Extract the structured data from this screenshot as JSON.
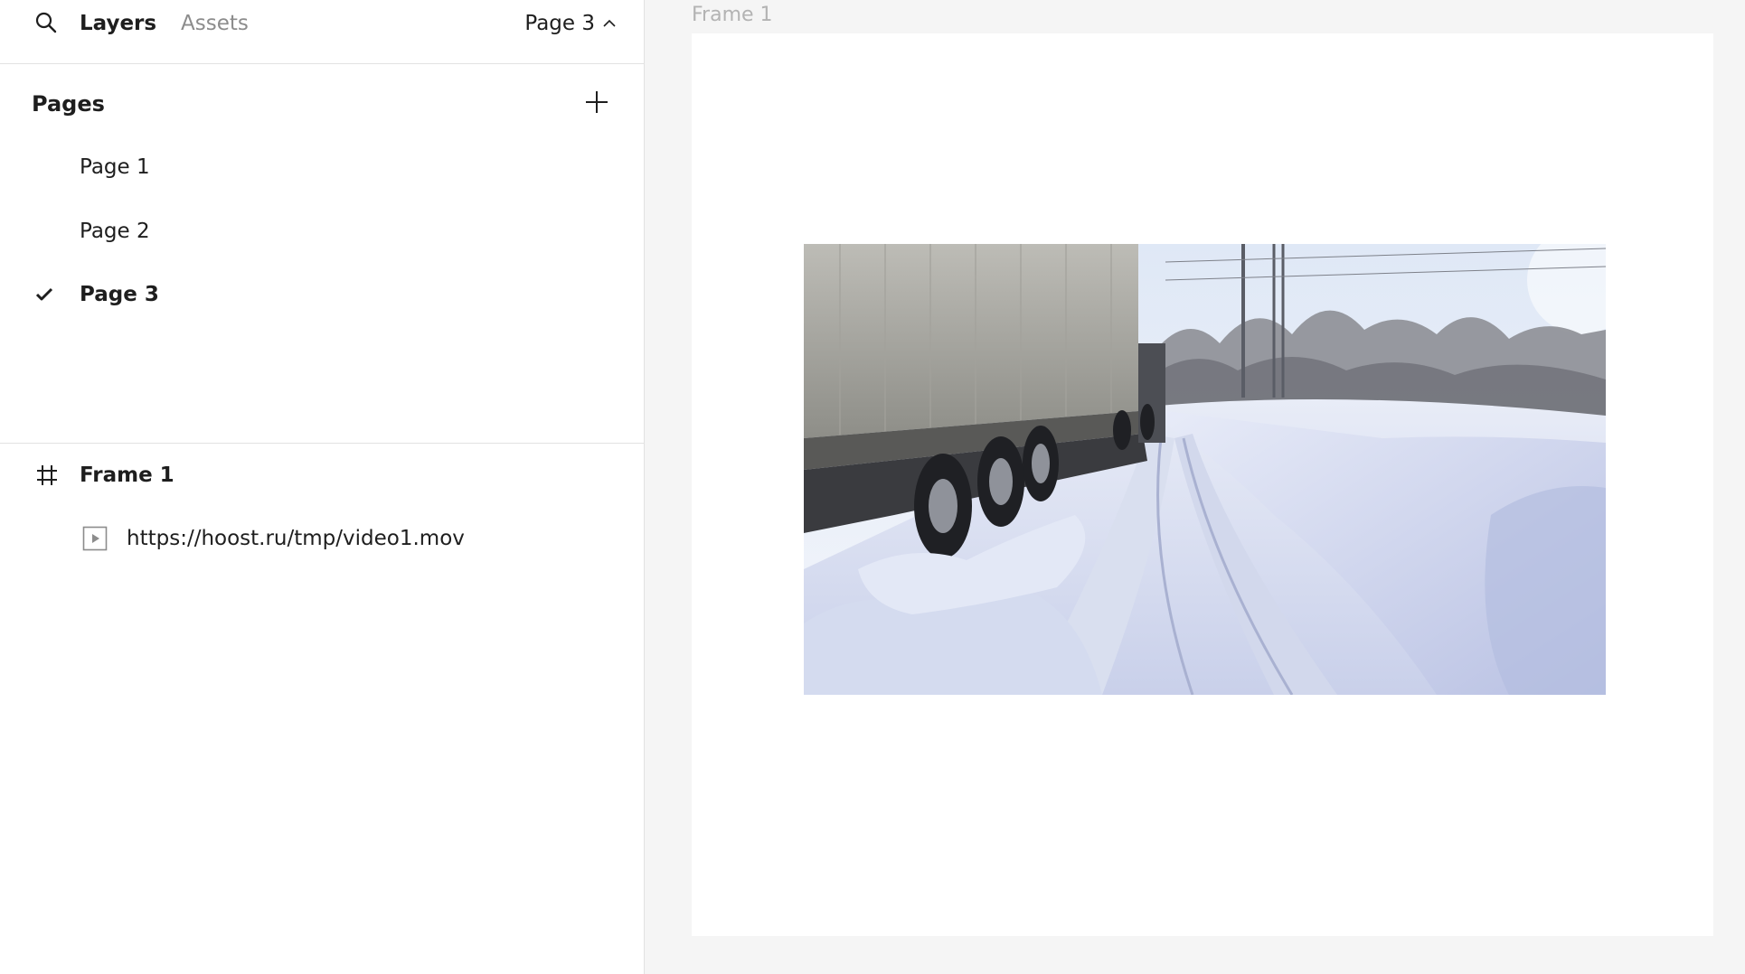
{
  "header": {
    "tabs": [
      {
        "label": "Layers",
        "active": true
      },
      {
        "label": "Assets",
        "active": false
      }
    ],
    "current_page": "Page 3",
    "search_icon": "search-icon",
    "chevron_icon": "chevron-up-icon"
  },
  "pages": {
    "title": "Pages",
    "add_icon": "plus-icon",
    "items": [
      {
        "label": "Page 1",
        "selected": false
      },
      {
        "label": "Page 2",
        "selected": false
      },
      {
        "label": "Page 3",
        "selected": true
      }
    ]
  },
  "layers": {
    "frame": {
      "label": "Frame 1",
      "icon": "frame-hash-icon"
    },
    "children": [
      {
        "label": "https://hoost.ru/tmp/video1.mov",
        "icon": "video-play-icon"
      }
    ]
  },
  "canvas": {
    "frame_label": "Frame 1",
    "video": {
      "content": "snowy road with truck trailer"
    }
  },
  "colors": {
    "panel_bg": "#ffffff",
    "canvas_bg": "#f5f5f5",
    "divider": "#e2e2e2",
    "muted_text": "#8c8c8c",
    "frame_label": "#b3b3b3"
  }
}
